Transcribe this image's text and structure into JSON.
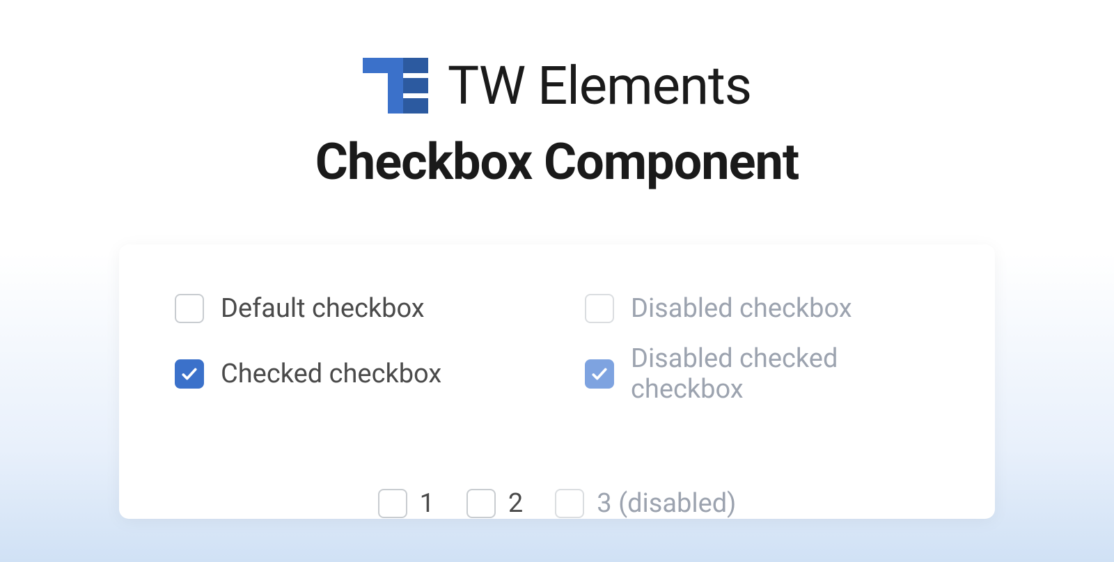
{
  "brand": {
    "name": "TW Elements",
    "logo_color_primary": "#3b71ca",
    "logo_color_dark": "#2c5aa0"
  },
  "subtitle": "Checkbox Component",
  "checkboxes": {
    "default": {
      "label": "Default checkbox",
      "checked": false,
      "disabled": false
    },
    "checked": {
      "label": "Checked checkbox",
      "checked": true,
      "disabled": false
    },
    "disabled": {
      "label": "Disabled checkbox",
      "checked": false,
      "disabled": true
    },
    "disabled_checked": {
      "label": "Disabled checked checkbox",
      "checked": true,
      "disabled": true
    }
  },
  "inline": {
    "item1": {
      "label": "1",
      "checked": false,
      "disabled": false
    },
    "item2": {
      "label": "2",
      "checked": false,
      "disabled": false
    },
    "item3": {
      "label": "3 (disabled)",
      "checked": false,
      "disabled": true
    }
  },
  "colors": {
    "primary": "#3b71ca",
    "primary_light": "#7ea3e0",
    "text": "#4a4a4a",
    "text_disabled": "#9ca3af",
    "border": "#c8ccd0",
    "border_disabled": "#dadde0"
  }
}
